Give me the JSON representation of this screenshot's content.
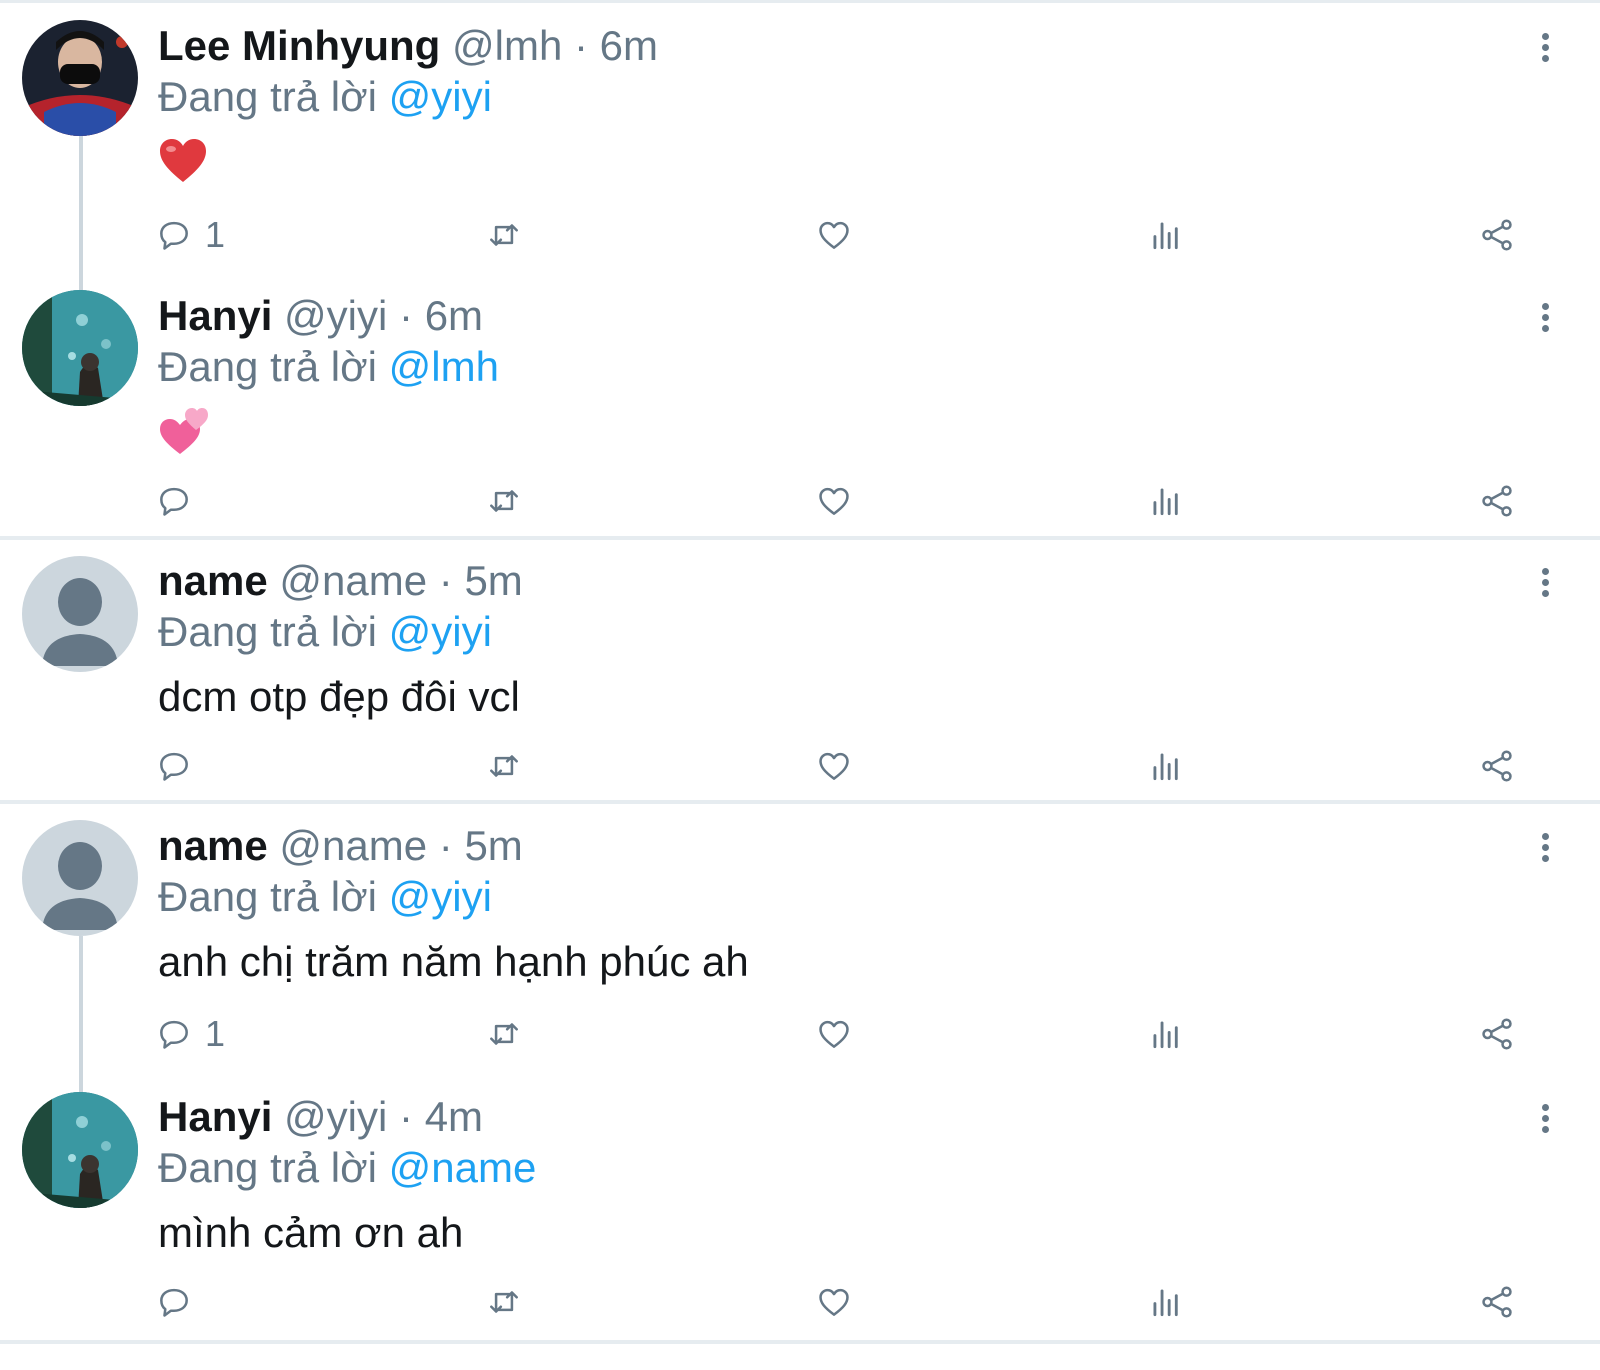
{
  "reply_prefix": "Đang trả lời",
  "tweets": [
    {
      "name": "Lee Minhyung",
      "handle": "@lmh",
      "dot": "·",
      "time": "6m",
      "reply_to": "@yiyi",
      "body": "",
      "emoji": "heart",
      "reply_count": "1",
      "avatar": "photo-dark"
    },
    {
      "name": "Hanyi",
      "handle": "@yiyi",
      "dot": "·",
      "time": "6m",
      "reply_to": "@lmh",
      "body": "",
      "emoji": "two-hearts",
      "reply_count": "",
      "avatar": "photo-aquarium"
    },
    {
      "name": "name",
      "handle": "@name",
      "dot": "·",
      "time": "5m",
      "reply_to": "@yiyi",
      "body": "dcm otp đẹp đôi vcl",
      "reply_count": "",
      "avatar": "default"
    },
    {
      "name": "name",
      "handle": "@name",
      "dot": "·",
      "time": "5m",
      "reply_to": "@yiyi",
      "body": "anh chị trăm năm hạnh phúc ah",
      "reply_count": "1",
      "avatar": "default"
    },
    {
      "name": "Hanyi",
      "handle": "@yiyi",
      "dot": "·",
      "time": "4m",
      "reply_to": "@name",
      "body": "mình cảm ơn ah",
      "reply_count": "",
      "avatar": "photo-aquarium"
    }
  ],
  "icons": {
    "reply": "reply-icon",
    "retweet": "retweet-icon",
    "like": "heart-icon",
    "analytics": "analytics-icon",
    "share": "share-icon",
    "more": "more-vertical-icon"
  },
  "colors": {
    "link": "#1da1f2",
    "secondary": "#657786",
    "text": "#14171a",
    "divider": "#e6ecf0",
    "heart": "#e0245e"
  }
}
